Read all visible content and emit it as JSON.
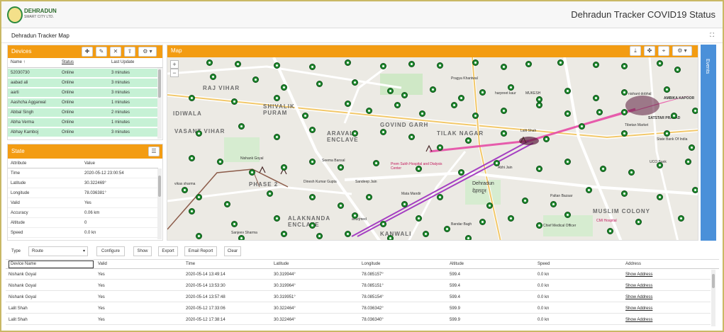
{
  "header": {
    "logo_title": "DEHRADUN",
    "logo_sub": "SMART CITY LTD.",
    "title": "Dehradun Tracker COVID19 Status"
  },
  "subheader": {
    "title": "Dehradun Tracker Map",
    "expand_icon": "expand-icon"
  },
  "devices": {
    "title": "Devices",
    "toolbar_icons": [
      "plus-icon",
      "edit-icon",
      "delete-icon",
      "upload-icon",
      "gear-icon"
    ],
    "columns": [
      "Name ↑",
      "Status",
      "Last Update"
    ],
    "rows": [
      {
        "name": "52030730",
        "status": "Online",
        "update": "3 minutes"
      },
      {
        "name": "aabad ali",
        "status": "Online",
        "update": "3 minutes"
      },
      {
        "name": "aarti",
        "status": "Online",
        "update": "3 minutes"
      },
      {
        "name": "Aashcha Aggarwal",
        "status": "Online",
        "update": "1 minutes"
      },
      {
        "name": "Abbal Singh",
        "status": "Online",
        "update": "2 minutes"
      },
      {
        "name": "Abha Verma",
        "status": "Online",
        "update": "1 minutes"
      },
      {
        "name": "Abhay Kamboj",
        "status": "Online",
        "update": "3 minutes"
      }
    ]
  },
  "state": {
    "title": "State",
    "menu_icon": "list-icon",
    "columns": [
      "Attribute",
      "Value"
    ],
    "rows": [
      {
        "attr": "Time",
        "value": "2020-05-12 23:00:54"
      },
      {
        "attr": "Latitude",
        "value": "30.322469°"
      },
      {
        "attr": "Longitude",
        "value": "78.036381°"
      },
      {
        "attr": "Valid",
        "value": "Yes"
      },
      {
        "attr": "Accuracy",
        "value": "0.06 km"
      },
      {
        "attr": "Altitude",
        "value": "0"
      },
      {
        "attr": "Speed",
        "value": "0.0 kn"
      }
    ]
  },
  "map": {
    "title": "Map",
    "zoom_in": "+",
    "zoom_out": "−",
    "toolbar_icons": [
      "download-icon",
      "paw-icon",
      "target-icon",
      "gear-icon"
    ],
    "areas": [
      "RAJ VIHAR",
      "SHIVALIK PURAM",
      "VASANT VIHAR",
      "ARAVALI ENCLAVE",
      "GOVIND GARH",
      "TILAK NAGAR",
      "KANWALI",
      "ALAKNANDA ENCLAVE",
      "MUSLIM COLONY",
      "PHASE 2",
      "IDIWALA",
      "RAJ VIHAR"
    ],
    "labels": [
      "Nishank Goyal",
      "Lalit Shah",
      "nishant dobhal",
      "vikas sharma",
      "Abhi Jain",
      "Sandeep Jain",
      "Seema Bansal",
      "Pragya Khantwal",
      "harpreet kaur",
      "MUKESH",
      "AMBIKA KAPOOR",
      "SATSTAR PRASAD",
      "Dinesh Kumar Gupta",
      "Mata Mandir",
      "Dehradun",
      "देहरादून",
      "Prem Sukh Hospital and Dialysis Center",
      "CMI Hospital",
      "Chief Medical Officer",
      "Tibetan Market",
      "State Bank Of India",
      "UCO Bank",
      "Paltan Bazaar",
      "Bandar Bagh",
      "Sanjeev Sharma",
      "anurjmed"
    ],
    "events_label": "Events"
  },
  "bottom": {
    "type_label": "Type",
    "type_value": "Route",
    "buttons": [
      "Configure",
      "Show",
      "Export",
      "Email Report",
      "Clear"
    ],
    "columns": [
      "Device Name",
      "Valid",
      "Time",
      "Latitude",
      "Longitude",
      "Altitude",
      "Speed",
      "Address"
    ],
    "rows": [
      {
        "device": "Nishank Goyal",
        "valid": "Yes",
        "time": "2020-05-14 13:49:14",
        "lat": "30.319944°",
        "lon": "78.085157°",
        "alt": "599.4",
        "speed": "0.0 kn",
        "addr": "Show Address"
      },
      {
        "device": "Nishank Goyal",
        "valid": "Yes",
        "time": "2020-05-14 13:53:30",
        "lat": "30.319964°",
        "lon": "78.085151°",
        "alt": "599.4",
        "speed": "0.0 kn",
        "addr": "Show Address"
      },
      {
        "device": "Nishank Goyal",
        "valid": "Yes",
        "time": "2020-05-14 13:57:48",
        "lat": "30.319951°",
        "lon": "78.085154°",
        "alt": "599.4",
        "speed": "0.0 kn",
        "addr": "Show Address"
      },
      {
        "device": "Lalit Shah",
        "valid": "Yes",
        "time": "2020-05-12 17:33:06",
        "lat": "30.322464°",
        "lon": "78.036342°",
        "alt": "599.9",
        "speed": "0.0 kn",
        "addr": "Show Address"
      },
      {
        "device": "Lalit Shah",
        "valid": "Yes",
        "time": "2020-05-12 17:38:14",
        "lat": "30.322464°",
        "lon": "78.036340°",
        "alt": "599.9",
        "speed": "0.0 kn",
        "addr": "Show Address"
      }
    ]
  }
}
